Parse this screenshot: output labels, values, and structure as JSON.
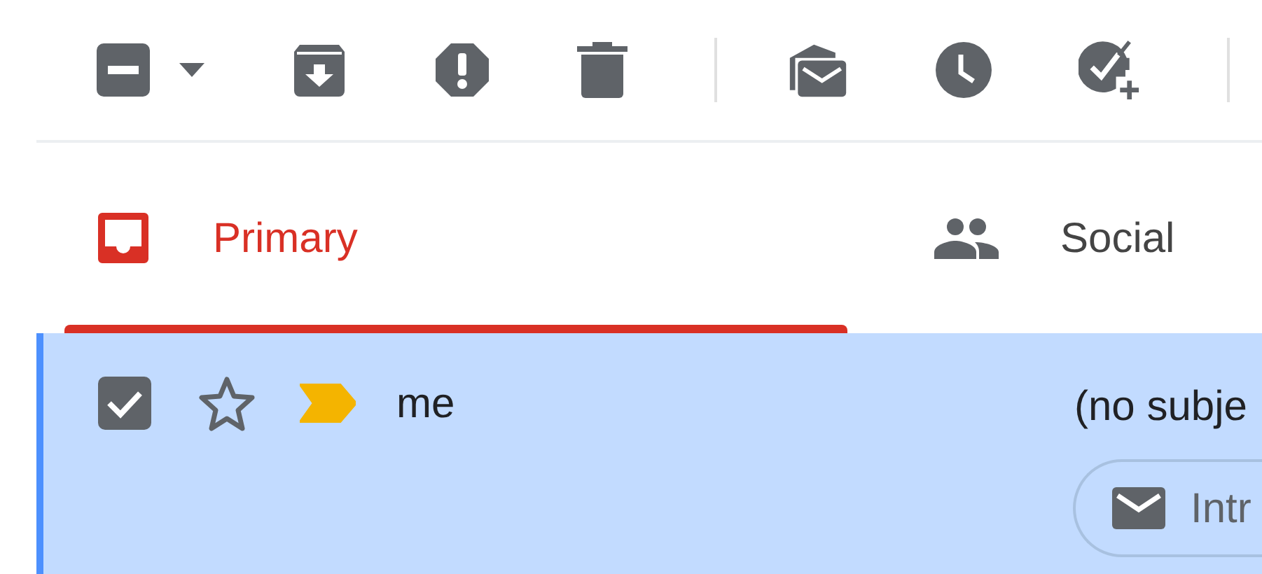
{
  "toolbar": [
    {
      "kind": "select"
    },
    {
      "kind": "archive"
    },
    {
      "kind": "spam"
    },
    {
      "kind": "delete"
    },
    {
      "kind": "divider"
    },
    {
      "kind": "mark-read"
    },
    {
      "kind": "snooze"
    },
    {
      "kind": "add-task"
    },
    {
      "kind": "divider"
    }
  ],
  "tabs": [
    {
      "kind": "primary",
      "label": "Primary",
      "selected": true
    },
    {
      "kind": "social",
      "label": "Social",
      "selected": false
    }
  ],
  "messages": [
    {
      "sender": "me",
      "subject": "(no subje",
      "selected": true,
      "checked": true,
      "starred": false,
      "important": true,
      "attachment": "Intr"
    }
  ]
}
